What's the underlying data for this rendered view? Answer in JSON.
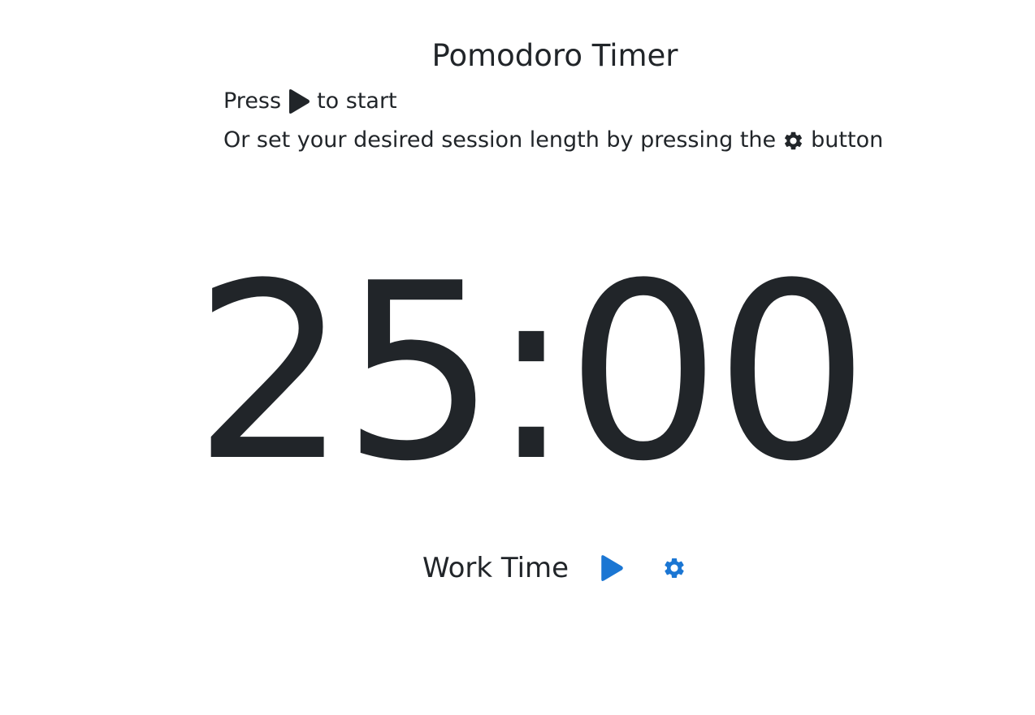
{
  "header": {
    "title": "Pomodoro Timer"
  },
  "instructions": {
    "line1_before": "Press",
    "line1_after": "to start",
    "line2_before": "Or set your desired session length by pressing the",
    "line2_after": "button"
  },
  "timer": {
    "display": "25:00"
  },
  "controls": {
    "session_label": "Work Time",
    "play_icon": "play-icon",
    "settings_icon": "gear-icon"
  },
  "colors": {
    "text": "#212529",
    "accent": "#1b76d3"
  }
}
